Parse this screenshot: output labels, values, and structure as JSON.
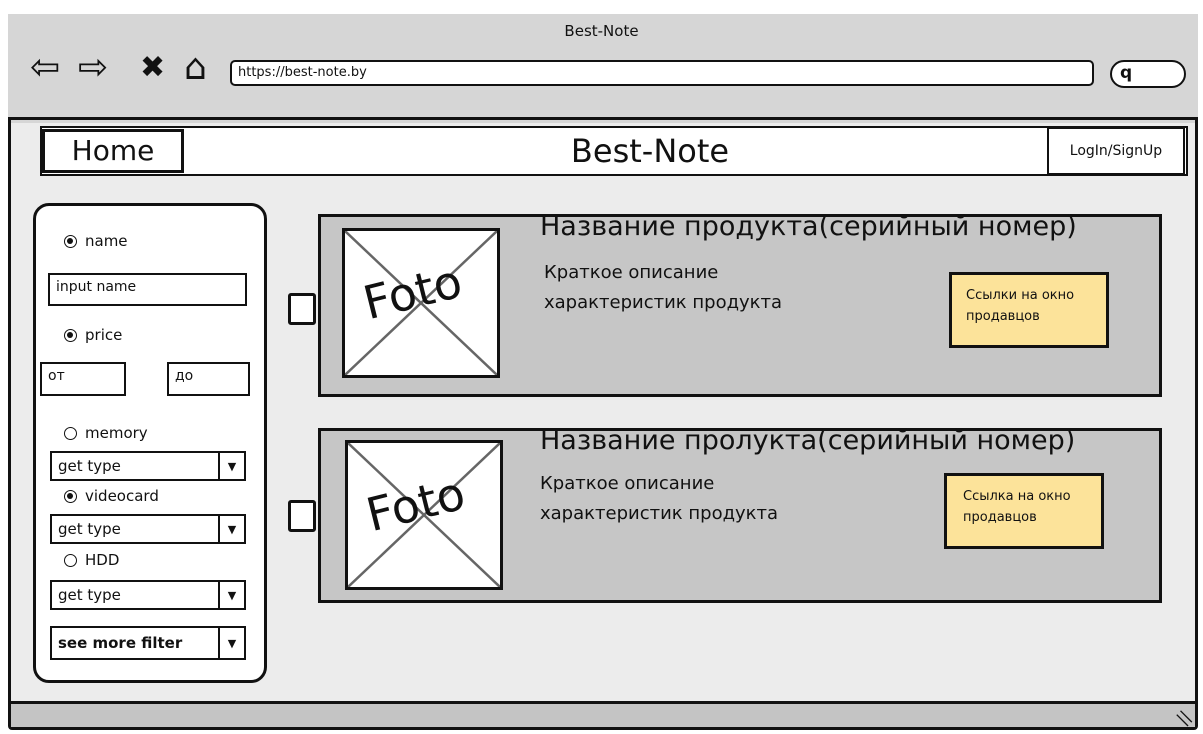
{
  "browser": {
    "title": "Best-Note",
    "url": "https://best-note.by",
    "nav": {
      "back_glyph": "⇦",
      "forward_glyph": "⇨",
      "close_glyph": "✖",
      "home_glyph": "⌂"
    },
    "search_glyph": "q"
  },
  "header": {
    "home_label": "Home",
    "title": "Best-Note",
    "login_label": "LogIn/SignUp"
  },
  "filters": {
    "name_label": "name",
    "name_placeholder": "input name",
    "price_label": "price",
    "price_from": "от",
    "price_to": "до",
    "memory_label": "memory",
    "memory_select": "get type",
    "videocard_label": "videocard",
    "videocard_select": "get type",
    "hdd_label": "HDD",
    "hdd_select": "get type",
    "more_label": "see more filter"
  },
  "products": [
    {
      "photo_label": "Foto",
      "title": "Название продукта(серийный номер)",
      "description": "Краткое описание характеристик продукта",
      "seller_link": "Ссылки на окно продавцов"
    },
    {
      "photo_label": "Foto",
      "title": "Название пролукта(серийный номер)",
      "description": "Краткое описание характеристик продукта",
      "seller_link": "Ссылка на окно продавцов"
    }
  ],
  "colors": {
    "card_bg": "#c6c6c6",
    "seller_link_bg": "#fce39a",
    "frame_bg": "#d6d6d6"
  }
}
